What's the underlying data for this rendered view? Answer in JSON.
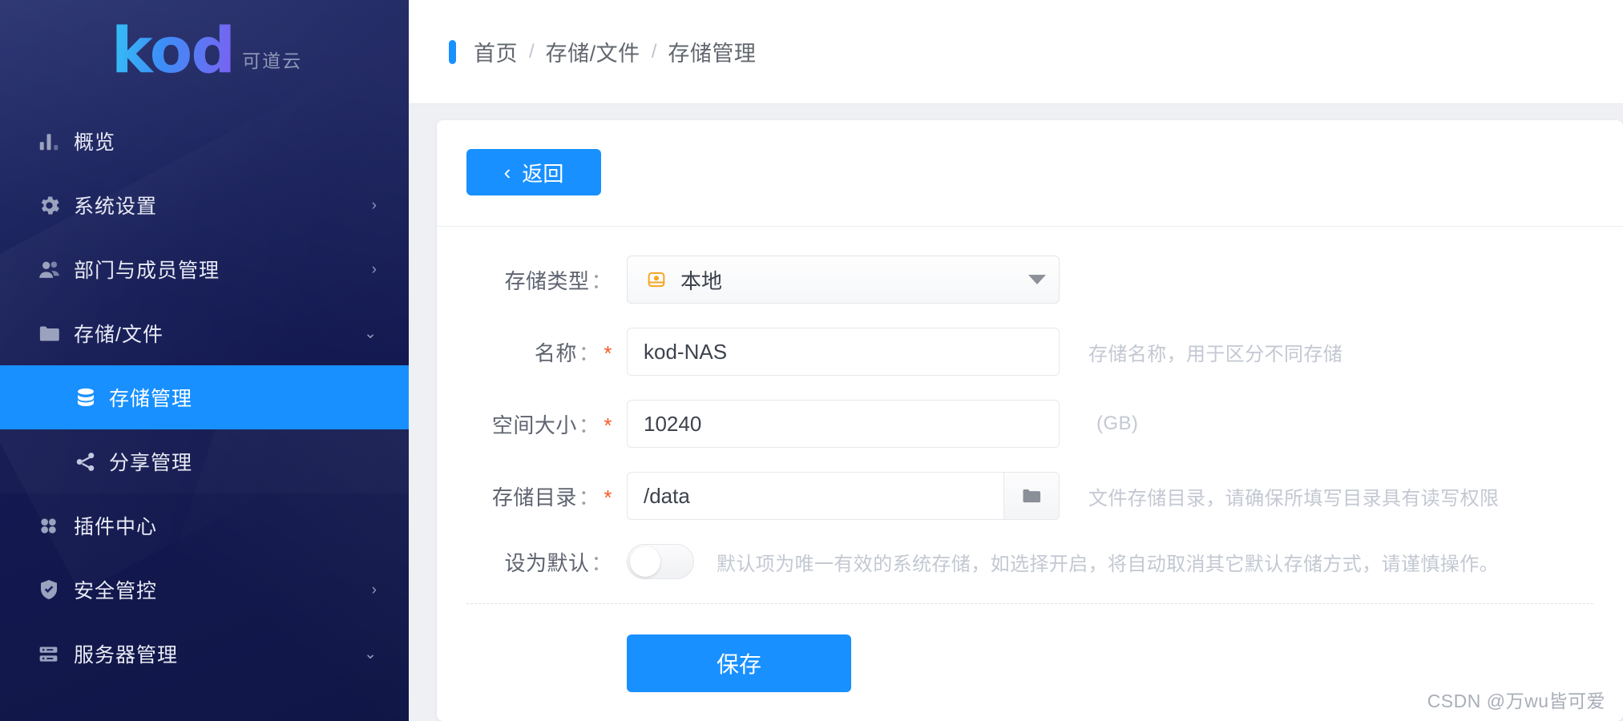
{
  "brand": {
    "logo_text": "kod",
    "logo_sub": "可道云"
  },
  "sidebar": {
    "items": [
      {
        "label": "概览",
        "icon": "bar-chart-icon",
        "arrow": ""
      },
      {
        "label": "系统设置",
        "icon": "gear-icon",
        "arrow": "›"
      },
      {
        "label": "部门与成员管理",
        "icon": "users-icon",
        "arrow": "›"
      },
      {
        "label": "存储/文件",
        "icon": "folder-icon",
        "arrow": "⌄"
      },
      {
        "label": "存储管理",
        "icon": "database-icon",
        "arrow": ""
      },
      {
        "label": "分享管理",
        "icon": "share-icon",
        "arrow": ""
      },
      {
        "label": "插件中心",
        "icon": "grid-icon",
        "arrow": ""
      },
      {
        "label": "安全管控",
        "icon": "shield-check-icon",
        "arrow": "›"
      },
      {
        "label": "服务器管理",
        "icon": "server-icon",
        "arrow": "⌄"
      }
    ],
    "active_label": "存储管理",
    "active_color": "#1890ff"
  },
  "breadcrumb": {
    "home": "首页",
    "sep1": "/",
    "section": "存储/文件",
    "sep2": "/",
    "current": "存储管理"
  },
  "toolbar": {
    "back_label": "返回",
    "back_chevron": "‹"
  },
  "form": {
    "storage_type": {
      "label": "存储类型",
      "colon": "：",
      "value": "本地",
      "icon": "drive-icon"
    },
    "name": {
      "label": "名称",
      "colon": "：",
      "required": "*",
      "value": "kod-NAS",
      "hint": "存储名称，用于区分不同存储"
    },
    "size": {
      "label": "空间大小",
      "colon": "：",
      "required": "*",
      "value": "10240",
      "hint": "(GB)"
    },
    "directory": {
      "label": "存储目录",
      "colon": "：",
      "required": "*",
      "value": "/data",
      "hint": "文件存储目录，请确保所填写目录具有读写权限",
      "browse_icon": "folder-icon"
    },
    "set_default": {
      "label": "设为默认",
      "colon": "：",
      "state": "off",
      "hint": "默认项为唯一有效的系统存储，如选择开启，将自动取消其它默认存储方式，请谨慎操作。"
    },
    "save_label": "保存"
  },
  "watermark": "CSDN @万wu皆可爱"
}
